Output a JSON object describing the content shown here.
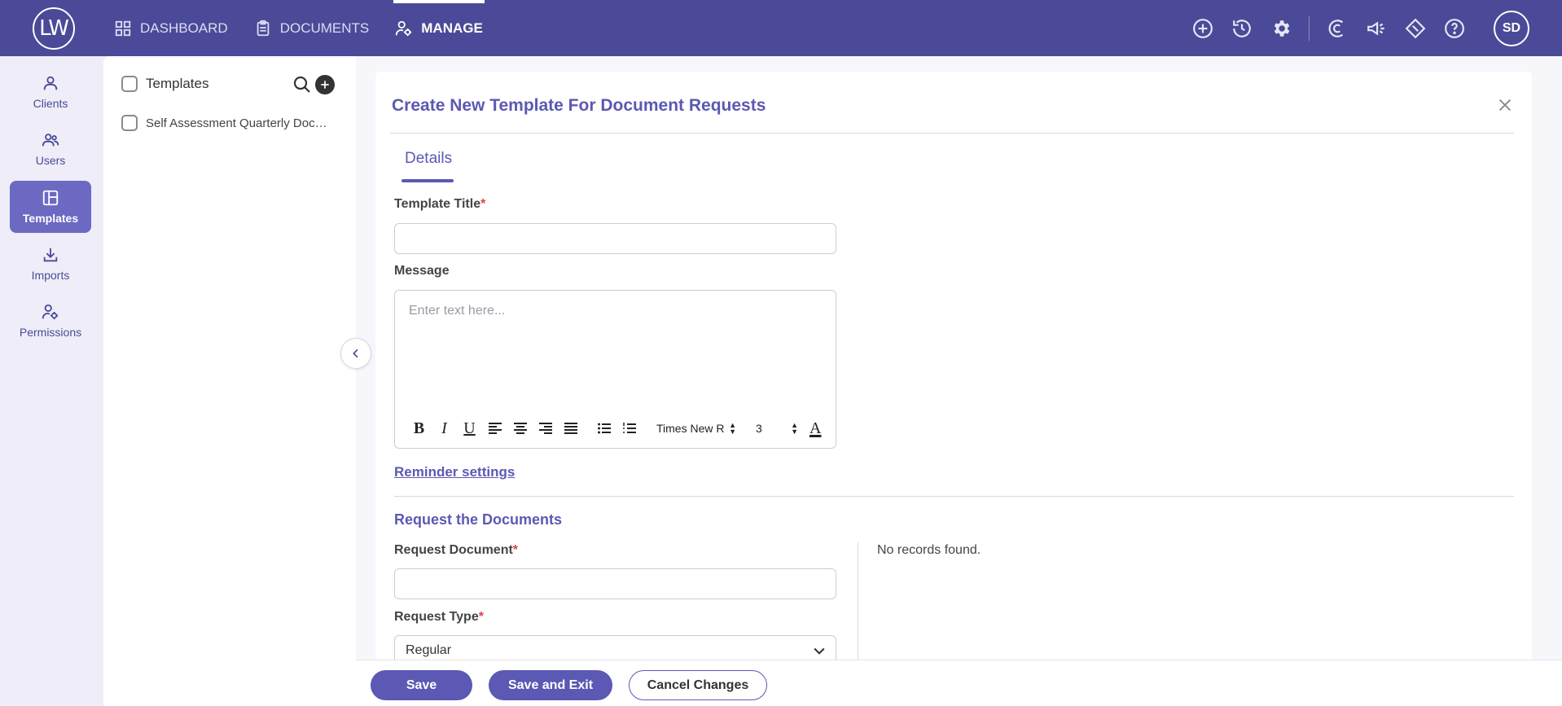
{
  "app": {
    "logo": "LW",
    "user_initials": "SD"
  },
  "nav": [
    {
      "label": "DASHBOARD",
      "icon": "grid-icon",
      "active": false
    },
    {
      "label": "DOCUMENTS",
      "icon": "clipboard-icon",
      "active": false
    },
    {
      "label": "MANAGE",
      "icon": "user-gear-icon",
      "active": true
    }
  ],
  "top_icons": [
    "add-circle-icon",
    "history-icon",
    "gear-icon",
    "c-logo-icon",
    "megaphone-icon",
    "ticket-icon",
    "help-icon"
  ],
  "rail": [
    {
      "label": "Clients",
      "icon": "person-icon",
      "active": false
    },
    {
      "label": "Users",
      "icon": "users-icon",
      "active": false
    },
    {
      "label": "Templates",
      "icon": "layout-icon",
      "active": true
    },
    {
      "label": "Imports",
      "icon": "download-icon",
      "active": false
    },
    {
      "label": "Permissions",
      "icon": "user-settings-icon",
      "active": false
    }
  ],
  "templates_panel": {
    "header": "Templates",
    "items": [
      "Self Assessment Quarterly Documents"
    ]
  },
  "form": {
    "title": "Create New Template For Document Requests",
    "tab": "Details",
    "template_title_label": "Template Title",
    "template_title_value": "",
    "message_label": "Message",
    "message_placeholder": "Enter text here...",
    "toolbar": {
      "bold": "B",
      "italic": "I",
      "underline": "U",
      "font": "Times New R",
      "size": "3",
      "color": "A"
    },
    "reminder_link": "Reminder settings",
    "section_title": "Request the Documents",
    "request_document_label": "Request Document",
    "request_document_value": "",
    "request_type_label": "Request Type",
    "request_type_value": "Regular",
    "no_records": "No records found.",
    "required_mark": "*"
  },
  "actions": {
    "save": "Save",
    "save_exit": "Save and Exit",
    "cancel": "Cancel Changes"
  }
}
